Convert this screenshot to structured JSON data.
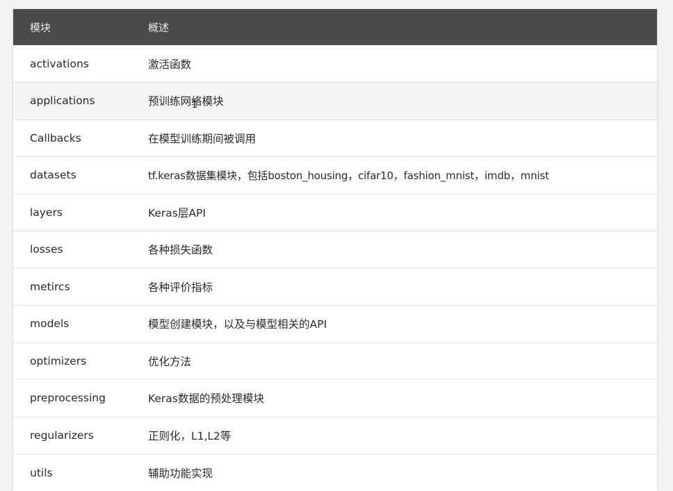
{
  "table": {
    "headers": [
      "模块",
      "概述"
    ],
    "rows": [
      {
        "module": "activations",
        "desc": "激活函数"
      },
      {
        "module": "applications",
        "desc": "预训练网络模块"
      },
      {
        "module": "Callbacks",
        "desc": "在模型训练期间被调用"
      },
      {
        "module": "datasets",
        "desc": "tf.keras数据集模块，包括boston_housing，cifar10，fashion_mnist，imdb，mnist"
      },
      {
        "module": "layers",
        "desc": "Keras层API"
      },
      {
        "module": "losses",
        "desc": "各种损失函数"
      },
      {
        "module": "metircs",
        "desc": "各种评价指标"
      },
      {
        "module": "models",
        "desc": "模型创建模块，以及与模型相关的API"
      },
      {
        "module": "optimizers",
        "desc": "优化方法"
      },
      {
        "module": "preprocessing",
        "desc": "Keras数据的预处理模块"
      },
      {
        "module": "regularizers",
        "desc": "正则化，L1,L2等"
      },
      {
        "module": "utils",
        "desc": "辅助功能实现"
      }
    ]
  },
  "colors": {
    "header_bg": "#4b4b4b",
    "header_text": "#e6e6e6",
    "row_highlight": "#f4f4f4"
  },
  "cursor_icon": "text-cursor-icon"
}
